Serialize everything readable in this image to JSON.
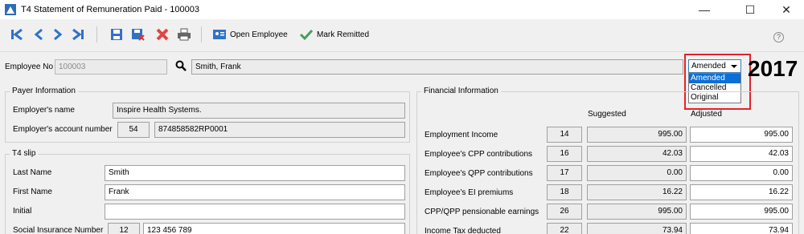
{
  "window": {
    "title": "T4 Statement of Remuneration Paid - 100003",
    "minimize": "—",
    "maximize": "☐",
    "close": "✕"
  },
  "toolbar": {
    "open_employee": "Open Employee",
    "mark_remitted": "Mark Remitted",
    "help": "?"
  },
  "employee": {
    "label": "Employee No",
    "number": "100003",
    "name": "Smith, Frank"
  },
  "status": {
    "selected": "Amended",
    "options": [
      "Amended",
      "Cancelled",
      "Original"
    ],
    "year": "2017"
  },
  "payer": {
    "title": "Payer Information",
    "employer_name_label": "Employer's name",
    "employer_name": "Inspire Health Systems.",
    "account_label": "Employer's account number",
    "account_box": "54",
    "account_number": "874858582RP0001"
  },
  "slip": {
    "title": "T4 slip",
    "last_name_label": "Last Name",
    "last_name": "Smith",
    "first_name_label": "First Name",
    "first_name": "Frank",
    "initial_label": "Initial",
    "initial": "",
    "sin_label": "Social Insurance Number",
    "sin_box": "12",
    "sin": "123 456 789"
  },
  "financial": {
    "title": "Financial Information",
    "col_suggested": "Suggested",
    "col_adjusted": "Adjusted",
    "rows": [
      {
        "label": "Employment Income",
        "box": "14",
        "suggested": "995.00",
        "adjusted": "995.00"
      },
      {
        "label": "Employee's CPP contributions",
        "box": "16",
        "suggested": "42.03",
        "adjusted": "42.03"
      },
      {
        "label": "Employee's QPP contributions",
        "box": "17",
        "suggested": "0.00",
        "adjusted": "0.00"
      },
      {
        "label": "Employee's EI premiums",
        "box": "18",
        "suggested": "16.22",
        "adjusted": "16.22"
      },
      {
        "label": "CPP/QPP pensionable earnings",
        "box": "26",
        "suggested": "995.00",
        "adjusted": "995.00"
      },
      {
        "label": "Income Tax deducted",
        "box": "22",
        "suggested": "73.94",
        "adjusted": "73.94"
      }
    ]
  }
}
